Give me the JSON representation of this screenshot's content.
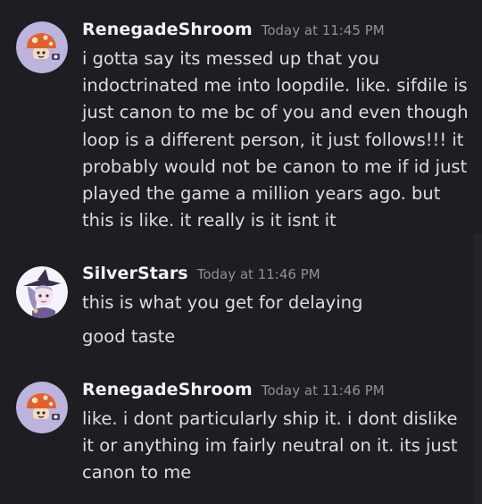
{
  "messages": [
    {
      "username": "RenegadeShroom",
      "timestamp": "Today at 11:45 PM",
      "avatar_icon": "mushroom-avatar-icon",
      "lines": [
        "i gotta say its messed up that you",
        "indoctrinated me into loopdile. like. sifdile is",
        "just canon to me bc of you and even though",
        "loop is a different person, it just follows!!! it",
        "probably would not be canon to me if id just",
        "played the game a million years ago. but",
        "this is like. it really is it isnt it"
      ]
    },
    {
      "username": "SilverStars",
      "timestamp": "Today at 11:46 PM",
      "avatar_icon": "witch-character-avatar-icon",
      "lines": [
        "this is what you get for delaying"
      ],
      "followups": [
        "good taste"
      ]
    },
    {
      "username": "RenegadeShroom",
      "timestamp": "Today at 11:46 PM",
      "avatar_icon": "mushroom-avatar-icon",
      "lines": [
        "like. i dont particularly ship it. i dont dislike",
        "it or anything im fairly neutral on it. its just",
        "canon to me"
      ]
    }
  ],
  "colors": {
    "background": "#1d1d22",
    "username": "#f2f3f5",
    "timestamp": "#8e9199",
    "text": "#dbdee1",
    "avatar_bg": "#bcb4dc"
  }
}
